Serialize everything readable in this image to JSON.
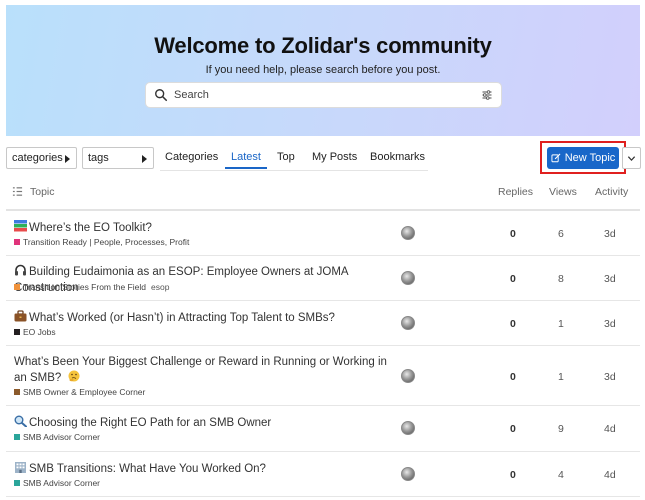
{
  "banner": {
    "title": "Welcome to Zolidar's community",
    "subtitle": "If you need help, please search before you post.",
    "search_placeholder": "Search"
  },
  "filters": {
    "categories_label": "categories",
    "tags_label": "tags"
  },
  "nav": {
    "tabs": [
      {
        "label": "Categories",
        "active": false
      },
      {
        "label": "Latest",
        "active": true
      },
      {
        "label": "Top",
        "active": false
      },
      {
        "label": "My Posts",
        "active": false
      },
      {
        "label": "Bookmarks",
        "active": false
      }
    ]
  },
  "actions": {
    "new_topic_label": "New Topic"
  },
  "table": {
    "headers": {
      "topic": "Topic",
      "replies": "Replies",
      "views": "Views",
      "activity": "Activity"
    },
    "rows": [
      {
        "icon": "books-emoji-icon",
        "title": "Where’s the EO Toolkit?",
        "category": "Transition Ready | People, Processes, Profit",
        "category_color": "#e0337a",
        "tag": "",
        "replies": "0",
        "views": "6",
        "activity": "3d"
      },
      {
        "icon": "headphones-emoji-icon",
        "title": "Building Eudaimonia as an ESOP: Employee Owners at JOMA Construction",
        "category": "Transition Stories From the Field",
        "category_color": "#f0923b",
        "tag": "esop",
        "replies": "0",
        "views": "8",
        "activity": "3d"
      },
      {
        "icon": "briefcase-emoji-icon",
        "title": "What’s Worked (or Hasn’t) in Attracting Top Talent to SMBs?",
        "category": "EO Jobs",
        "category_color": "#231f20",
        "tag": "",
        "replies": "0",
        "views": "1",
        "activity": "3d"
      },
      {
        "icon": "thinking-face-emoji-icon",
        "title": "What’s Been Your Biggest Challenge or Reward in Running or Working in an SMB?",
        "category": "SMB Owner & Employee Corner",
        "category_color": "#8b5a2b",
        "tag": "",
        "replies": "0",
        "views": "1",
        "activity": "3d"
      },
      {
        "icon": "magnifier-emoji-icon",
        "title": "Choosing the Right EO Path for an SMB Owner",
        "category": "SMB Advisor Corner",
        "category_color": "#2aa59a",
        "tag": "",
        "replies": "0",
        "views": "9",
        "activity": "4d"
      },
      {
        "icon": "office-building-emoji-icon",
        "title": "SMB Transitions: What Have You Worked On?",
        "category": "SMB Advisor Corner",
        "category_color": "#2aa59a",
        "tag": "",
        "replies": "0",
        "views": "4",
        "activity": "4d"
      }
    ]
  },
  "colors": {
    "accent": "#1967c9",
    "highlight": "#e0201f"
  }
}
